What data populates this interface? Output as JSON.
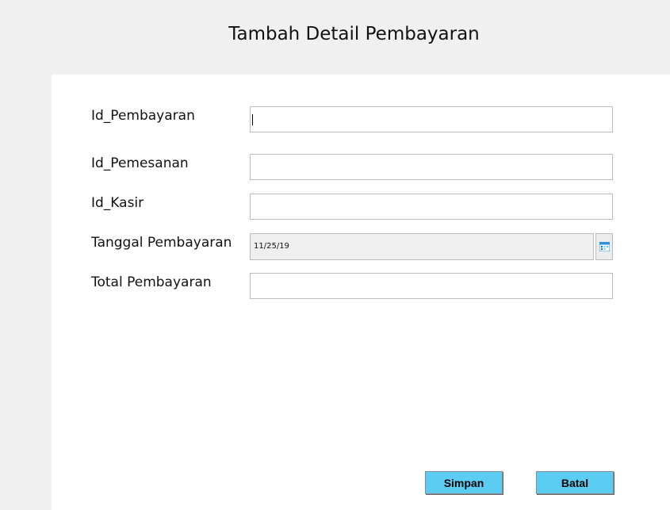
{
  "form": {
    "title": "Tambah Detail Pembayaran",
    "fields": {
      "id_pembayaran": {
        "label": "Id_Pembayaran",
        "value": ""
      },
      "id_pemesanan": {
        "label": "Id_Pemesanan",
        "value": ""
      },
      "id_kasir": {
        "label": "Id_Kasir",
        "value": ""
      },
      "tanggal_pembayaran": {
        "label": "Tanggal Pembayaran",
        "value": "11/25/19",
        "icon": "calendar-icon"
      },
      "total_pembayaran": {
        "label": "Total Pembayaran",
        "value": ""
      }
    },
    "buttons": {
      "save_label": "Simpan",
      "cancel_label": "Batal"
    }
  },
  "colors": {
    "window_bg": "#f0f0f0",
    "panel_bg": "#ffffff",
    "button_bg": "#5bcdf2",
    "date_field_bg": "#efefef"
  }
}
